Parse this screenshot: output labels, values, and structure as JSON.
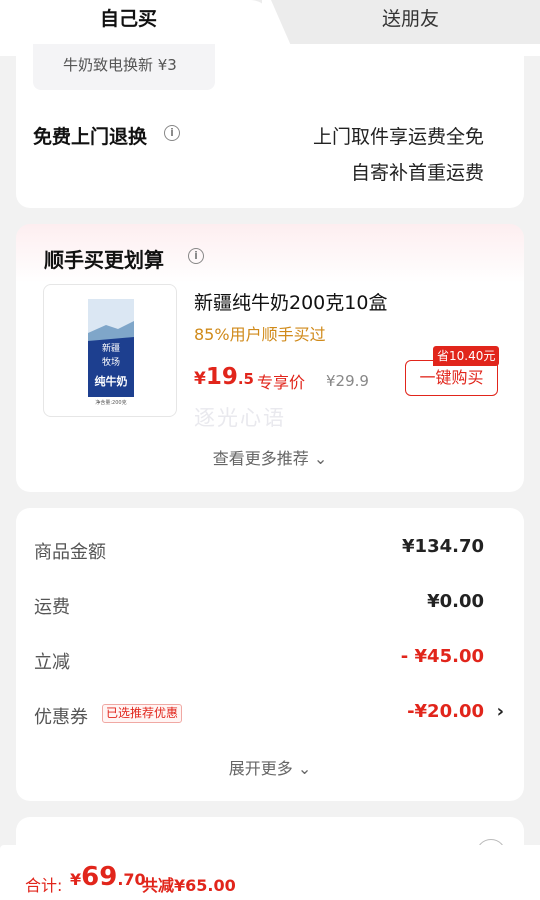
{
  "tabs": {
    "self": "自己买",
    "friend": "送朋友"
  },
  "card_top": {
    "leftover_text": "牛奶致电换新 ¥3",
    "return_title": "免费上门退换",
    "return_line1": "上门取件享运费全免",
    "return_line2": "自寄补首重运费"
  },
  "recommend": {
    "title": "顺手买更划算",
    "product": {
      "name": "新疆纯牛奶200克10盒",
      "sub": "85%用户顺手买过",
      "price_currency": "¥",
      "price_int": "19",
      "price_dec": ".5",
      "price_tag": "专享价",
      "old_price": "¥29.9",
      "save_badge": "省10.40元",
      "buy_button": "一键购买",
      "box_brand": "新疆",
      "box_farm": "牧场",
      "box_text": "纯牛奶",
      "box_net": "净含量:200克"
    },
    "watermark": "逐光心语",
    "more": "查看更多推荐 ⌄"
  },
  "summary": {
    "goods_label": "商品金额",
    "goods_value": "¥134.70",
    "shipping_label": "运费",
    "shipping_value": "¥0.00",
    "discount_label": "立减",
    "discount_value": "- ¥45.00",
    "coupon_label": "优惠券",
    "coupon_tag": "已选推荐优惠",
    "coupon_value": "-¥20.00",
    "expand": "展开更多 ⌄"
  },
  "bottom": {
    "total_label": "合计:",
    "total_currency": "¥",
    "total_int": "69",
    "total_dec": ".70",
    "total_save": "共减¥65.00"
  },
  "colors": {
    "accent": "#e1251b",
    "orange": "#d08a1a",
    "bg": "#f2f2f2"
  },
  "icons": [
    "info-icon",
    "chevron-down-icon",
    "chevron-right-icon"
  ]
}
